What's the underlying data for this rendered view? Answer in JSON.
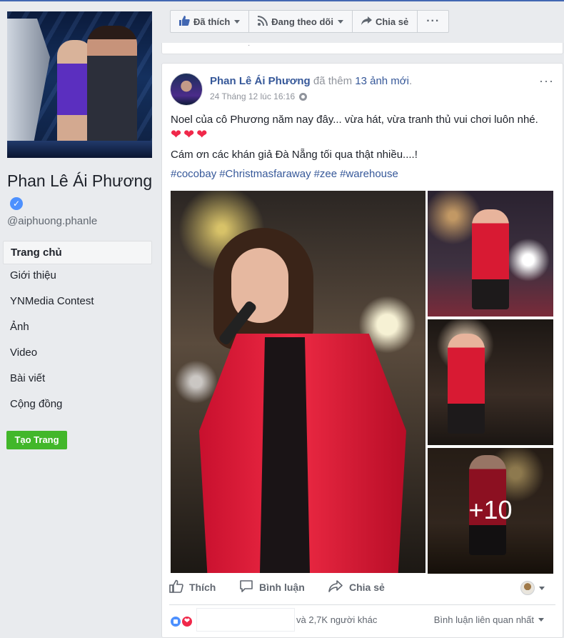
{
  "page": {
    "name": "Phan Lê Ái Phương",
    "handle": "@aiphuong.phanle",
    "verified_icon": "✓",
    "nav": [
      "Trang chủ",
      "Giới thiệu",
      "YNMedia Contest",
      "Ảnh",
      "Video",
      "Bài viết",
      "Cộng đồng"
    ],
    "create_page_label": "Tạo Trang"
  },
  "actionbar": {
    "liked_label": "Đã thích",
    "following_label": "Đang theo dõi",
    "share_label": "Chia sẻ",
    "more_label": "···"
  },
  "post": {
    "author": "Phan Lê Ái Phương",
    "action_prefix": "đã thêm",
    "photo_count_text": "13 ảnh mới",
    "action_suffix": ".",
    "timestamp": "24 Tháng 12 lúc 16:16",
    "menu": "···",
    "text_line1": "Noel của cô Phương năm nay đây... vừa hát, vừa tranh thủ vui chơi luôn nhé.",
    "hearts": [
      "❤",
      "❤",
      "❤"
    ],
    "text_line2": "Cám ơn các khán giả Đà Nẵng tối qua thật nhiều....!",
    "hashtags": [
      "#cocobay",
      "#Christmasfaraway",
      "#zee",
      "#warehouse"
    ],
    "more_photos_label": "+10",
    "actions": {
      "like": "Thích",
      "comment": "Bình luận",
      "share": "Chia sẻ"
    },
    "reactions_text": "và 2,7K người khác",
    "sort_label": "Bình luận liên quan nhất"
  },
  "colors": {
    "link": "#365899",
    "brand": "#4267b2",
    "create_button": "#42b72a",
    "heart": "#f0284a"
  }
}
